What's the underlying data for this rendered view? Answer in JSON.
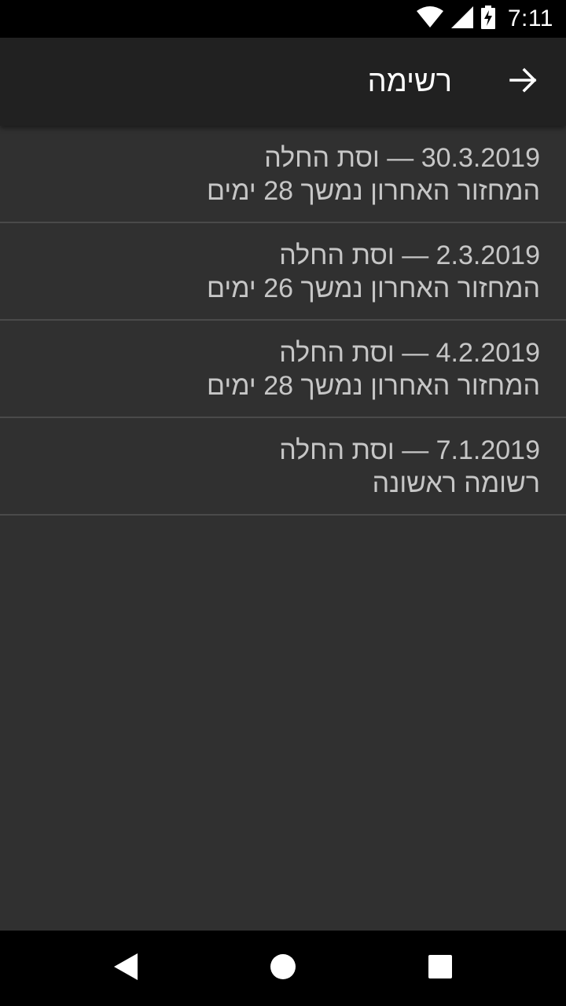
{
  "status_bar": {
    "time": "7:11",
    "icons": [
      "wifi-icon",
      "signal-icon",
      "battery-charging-icon"
    ]
  },
  "app_bar": {
    "title": "רשימה",
    "back_icon": "arrow-right-icon"
  },
  "list": {
    "items": [
      {
        "title": "30.3.2019 — וסת החלה",
        "subtitle": "המחזור האחרון נמשך 28 ימים"
      },
      {
        "title": "2.3.2019 — וסת החלה",
        "subtitle": "המחזור האחרון נמשך 26 ימים"
      },
      {
        "title": "4.2.2019 — וסת החלה",
        "subtitle": "המחזור האחרון נמשך 28 ימים"
      },
      {
        "title": "7.1.2019 — וסת החלה",
        "subtitle": "רשומה ראשונה"
      }
    ]
  },
  "nav_bar": {
    "icons": [
      "back-triangle-icon",
      "home-circle-icon",
      "recents-square-icon"
    ]
  },
  "colors": {
    "background": "#303030",
    "app_bar": "#212121",
    "text": "#c6c6c6",
    "divider": "#4a4a4a"
  }
}
